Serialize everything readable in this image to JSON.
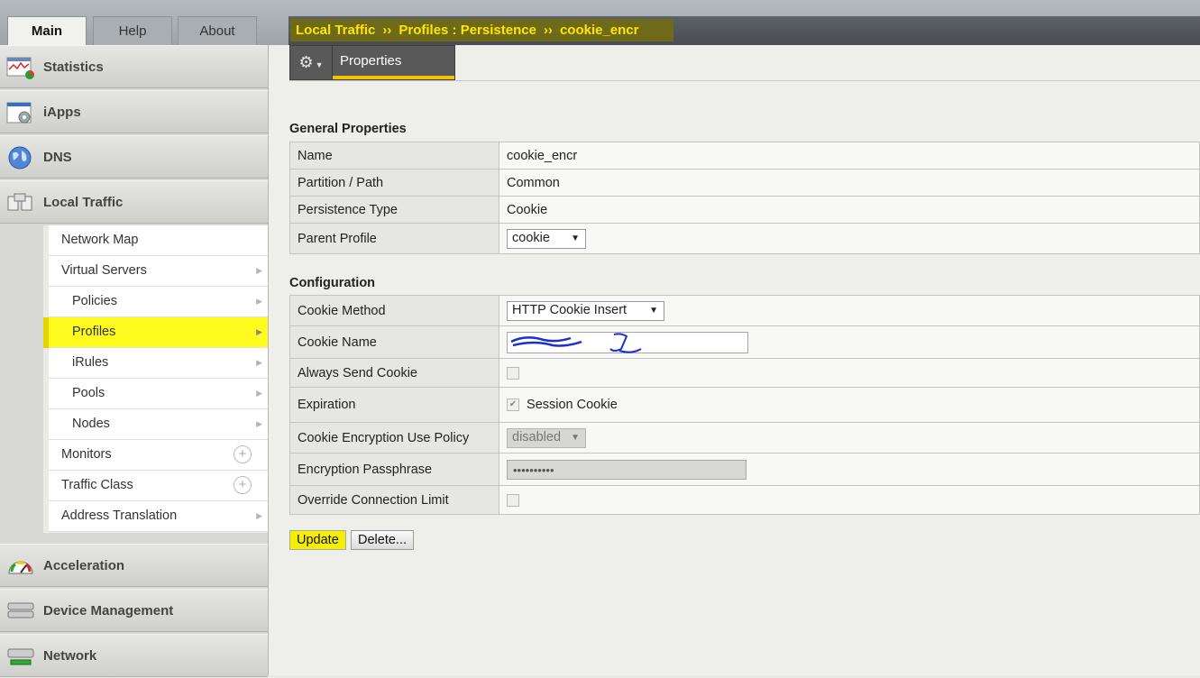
{
  "tabs": [
    {
      "label": "Main",
      "active": true
    },
    {
      "label": "Help",
      "active": false
    },
    {
      "label": "About",
      "active": false
    }
  ],
  "breadcrumb": {
    "items": [
      "Local Traffic",
      "Profiles : Persistence",
      "cookie_encr"
    ],
    "separator": "››"
  },
  "sidebar": {
    "sections_top": [
      {
        "label": "Statistics",
        "icon": "statistics-icon"
      },
      {
        "label": "iApps",
        "icon": "iapps-icon"
      },
      {
        "label": "DNS",
        "icon": "globe-icon"
      },
      {
        "label": "Local Traffic",
        "icon": "local-traffic-icon"
      }
    ],
    "local_traffic_items": [
      {
        "label": "Network Map",
        "level": 1,
        "marker": "none"
      },
      {
        "label": "Virtual Servers",
        "level": 1,
        "marker": "arrow"
      },
      {
        "label": "Policies",
        "level": 2,
        "marker": "arrow"
      },
      {
        "label": "Profiles",
        "level": 2,
        "marker": "arrow",
        "selected": true
      },
      {
        "label": "iRules",
        "level": 2,
        "marker": "arrow"
      },
      {
        "label": "Pools",
        "level": 2,
        "marker": "arrow"
      },
      {
        "label": "Nodes",
        "level": 2,
        "marker": "arrow"
      },
      {
        "label": "Monitors",
        "level": 1,
        "marker": "plus"
      },
      {
        "label": "Traffic Class",
        "level": 1,
        "marker": "plus"
      },
      {
        "label": "Address Translation",
        "level": 1,
        "marker": "arrow"
      }
    ],
    "sections_bottom": [
      {
        "label": "Acceleration",
        "icon": "gauge-icon"
      },
      {
        "label": "Device Management",
        "icon": "device-icon"
      },
      {
        "label": "Network",
        "icon": "network-icon"
      }
    ]
  },
  "toolbar": {
    "tab_label": "Properties"
  },
  "general": {
    "title": "General Properties",
    "rows": {
      "name": {
        "label": "Name",
        "value": "cookie_encr"
      },
      "partition": {
        "label": "Partition / Path",
        "value": "Common"
      },
      "type": {
        "label": "Persistence Type",
        "value": "Cookie"
      },
      "parent": {
        "label": "Parent Profile",
        "value": "cookie"
      }
    }
  },
  "config": {
    "title": "Configuration",
    "rows": {
      "method": {
        "label": "Cookie Method",
        "value": "HTTP Cookie Insert"
      },
      "cookie_name": {
        "label": "Cookie Name",
        "value": ""
      },
      "always_send": {
        "label": "Always Send Cookie",
        "checked": false
      },
      "expiration": {
        "label": "Expiration",
        "option": "Session Cookie",
        "checked": true
      },
      "enc_policy": {
        "label": "Cookie Encryption Use Policy",
        "value": "disabled"
      },
      "passphrase": {
        "label": "Encryption Passphrase",
        "value": "••••••••••"
      },
      "override": {
        "label": "Override Connection Limit",
        "checked": false
      }
    }
  },
  "buttons": {
    "update": "Update",
    "delete": "Delete..."
  },
  "colors": {
    "highlight": "#fffb1e",
    "breadcrumb_text": "#ffe600",
    "tab_underline": "#f1c300",
    "annotation": "#1a2fd1"
  }
}
